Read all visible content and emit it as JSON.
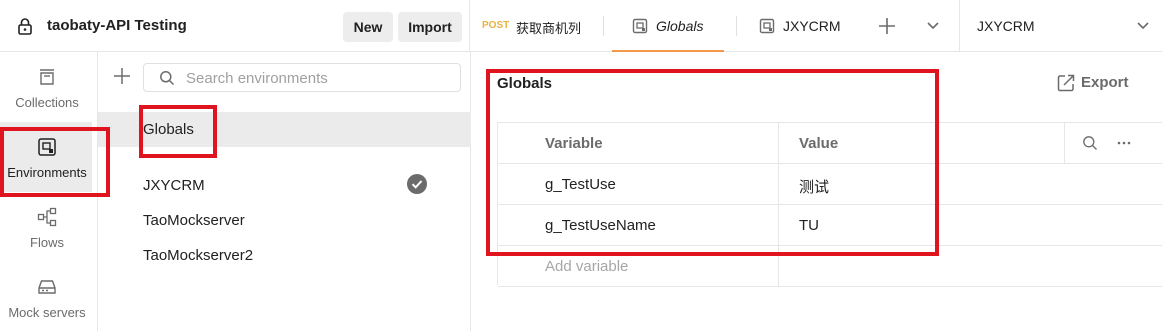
{
  "workspace": {
    "name": "taobaty-API Testing",
    "new_label": "New",
    "import_label": "Import"
  },
  "tabs": [
    {
      "method": "POST",
      "label": "获取商机列",
      "active": false
    },
    {
      "label": "Globals",
      "active": true
    },
    {
      "label": "JXYCRM",
      "active": false
    }
  ],
  "environment_selector": {
    "value": "JXYCRM"
  },
  "rail": {
    "items": [
      {
        "label": "Collections",
        "icon": "collections-icon"
      },
      {
        "label": "Environments",
        "icon": "environments-icon",
        "active": true
      },
      {
        "label": "Flows",
        "icon": "flows-icon"
      },
      {
        "label": "Mock servers",
        "icon": "mock-servers-icon"
      }
    ]
  },
  "sidebar": {
    "search_placeholder": "Search environments",
    "items": [
      {
        "name": "Globals",
        "selected": true
      },
      {
        "name": "JXYCRM",
        "active_env": true
      },
      {
        "name": "TaoMockserver"
      },
      {
        "name": "TaoMockserver2"
      }
    ]
  },
  "main": {
    "title": "Globals",
    "export_label": "Export",
    "table": {
      "headers": {
        "variable": "Variable",
        "value": "Value"
      },
      "rows": [
        {
          "variable": "g_TestUse",
          "value": "测试"
        },
        {
          "variable": "g_TestUseName",
          "value": "TU"
        }
      ],
      "add_placeholder": "Add variable"
    }
  },
  "colors": {
    "highlight": "#e0141e",
    "post_method": "#e8b341",
    "active_tab_underline": "#f2994a"
  }
}
